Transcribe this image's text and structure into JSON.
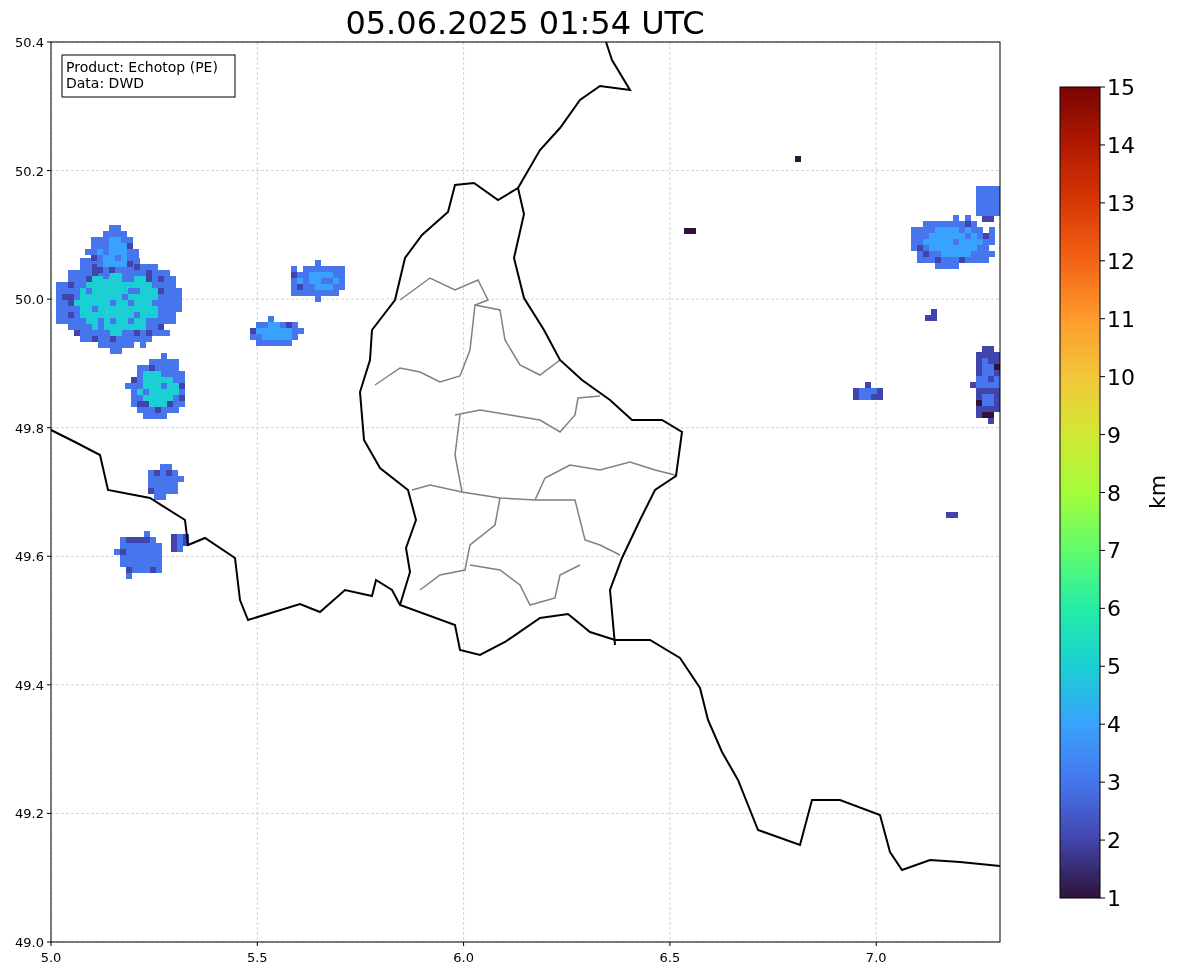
{
  "title": "05.06.2025 01:54 UTC",
  "legend": [
    "Product: Echotop (PE)",
    "Data: DWD"
  ],
  "x_ticks": [
    "5.0",
    "5.5",
    "6.0",
    "6.5",
    "7.0"
  ],
  "y_ticks": [
    "50.4",
    "50.2",
    "50.0",
    "49.8",
    "49.6",
    "49.4",
    "49.2",
    "49.0"
  ],
  "colorbar": {
    "ticks": [
      "15",
      "14",
      "13",
      "12",
      "11",
      "10",
      "9",
      "8",
      "7",
      "6",
      "5",
      "4",
      "3",
      "2",
      "1"
    ],
    "label": "km"
  }
}
